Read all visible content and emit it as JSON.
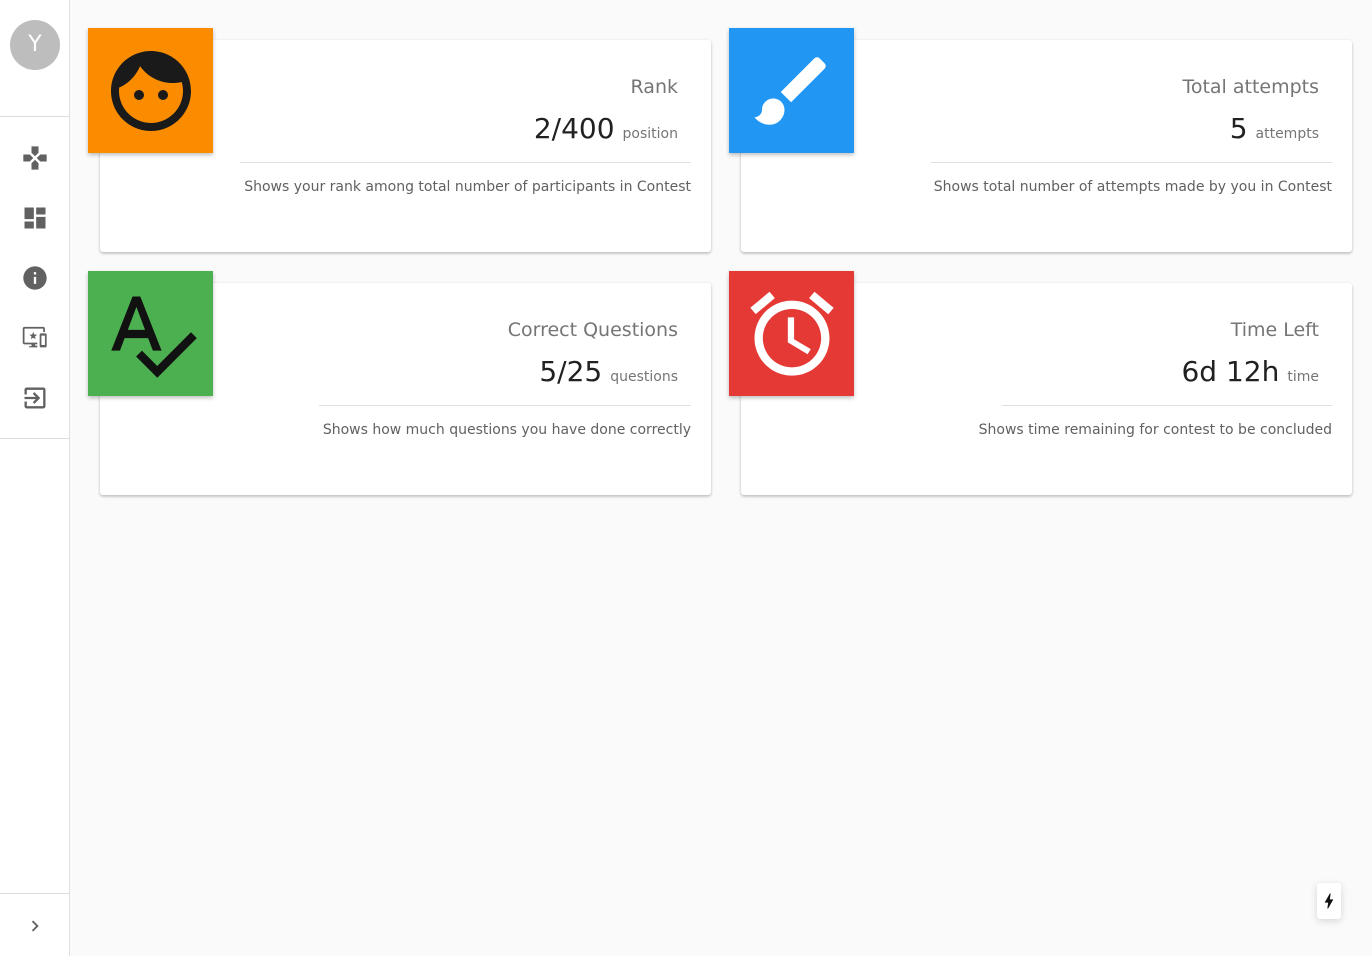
{
  "user": {
    "avatar_letter": "Y"
  },
  "sidebar": {
    "items": [
      {
        "name": "games"
      },
      {
        "name": "dashboard"
      },
      {
        "name": "info"
      },
      {
        "name": "featured"
      },
      {
        "name": "login"
      }
    ]
  },
  "cards": [
    {
      "title": "Rank",
      "value": "2/400",
      "unit": "position",
      "description": "Shows your rank among total number of participants in Contest",
      "icon": "face-icon",
      "color": "#fb8c00"
    },
    {
      "title": "Total attempts",
      "value": "5",
      "unit": "attempts",
      "description": "Shows total number of attempts made by you in Contest",
      "icon": "brush-icon",
      "color": "#2196f3"
    },
    {
      "title": "Correct Questions",
      "value": "5/25",
      "unit": "questions",
      "description": "Shows how much questions you have done correctly",
      "icon": "spellcheck-icon",
      "color": "#4caf50"
    },
    {
      "title": "Time Left",
      "value": "6d 12h",
      "unit": "time",
      "description": "Shows time remaining for contest to be concluded",
      "icon": "alarm-icon",
      "color": "#e53935"
    }
  ]
}
